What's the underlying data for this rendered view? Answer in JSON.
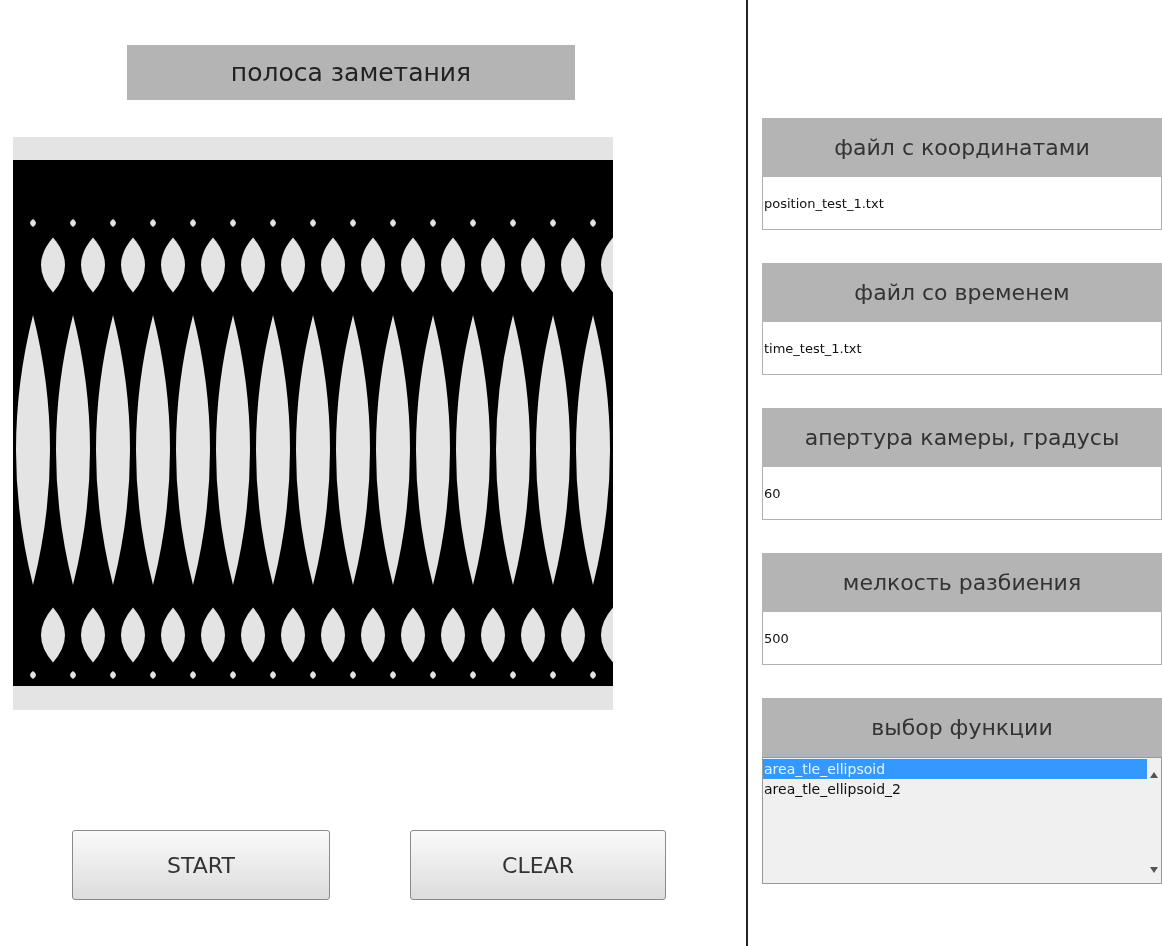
{
  "plot_title": "полоса заметания",
  "buttons": [
    {
      "label": "START"
    },
    {
      "label": "CLEAR"
    }
  ],
  "fields": [
    {
      "label": "файл с координатами",
      "value": "position_test_1.txt"
    },
    {
      "label": "файл со временем",
      "value": "time_test_1.txt"
    },
    {
      "label": "апертура камеры, градусы",
      "value": "60"
    },
    {
      "label": "мелкость разбиения",
      "value": "500"
    }
  ],
  "function_select": {
    "label": "выбор функции",
    "items": [
      {
        "text": "area_tle_ellipsoid",
        "selected": true
      },
      {
        "text": "area_tle_ellipsoid_2",
        "selected": false
      }
    ]
  }
}
